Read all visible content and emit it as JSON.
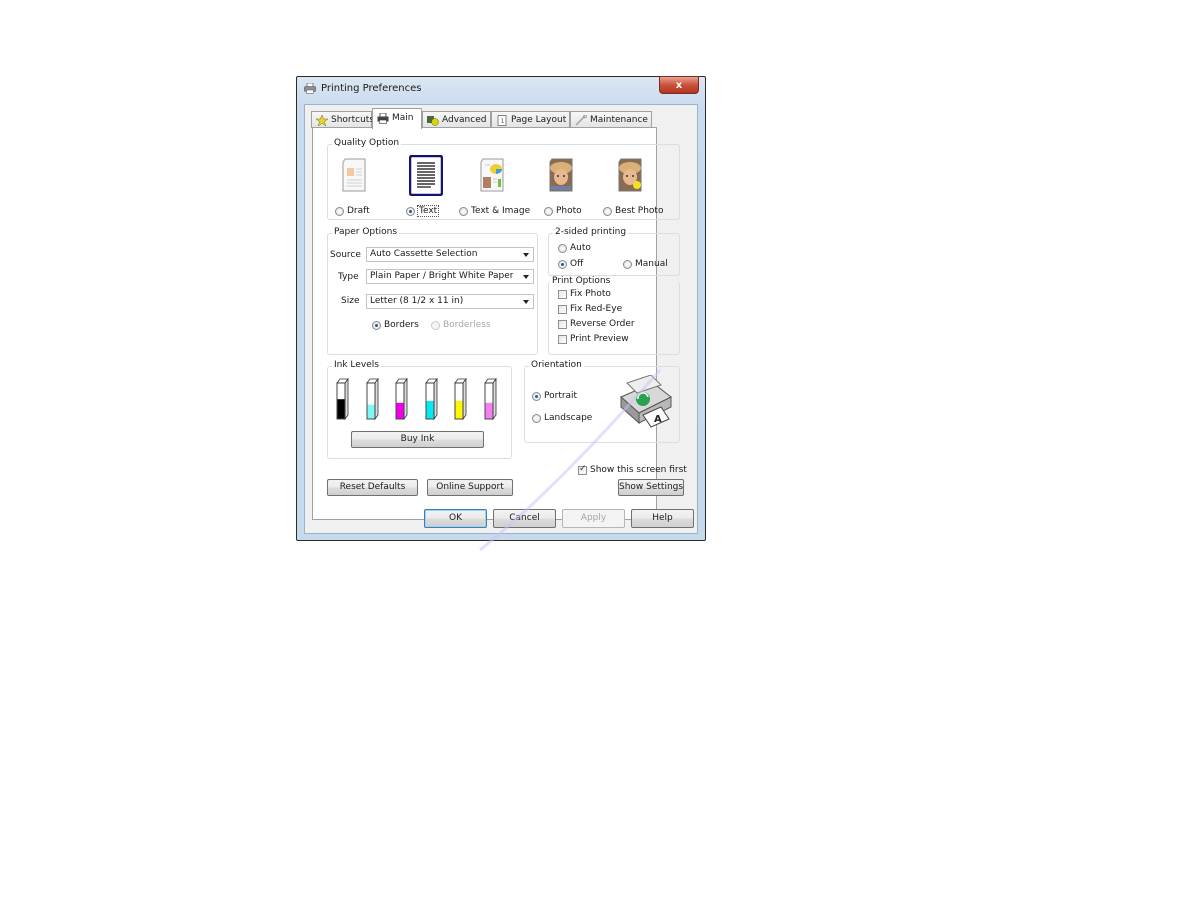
{
  "window": {
    "title": "Printing Preferences",
    "close_label": "x"
  },
  "tabs": [
    {
      "label": "Shortcuts",
      "icon": "star-icon",
      "active": false
    },
    {
      "label": "Main",
      "icon": "printer-icon",
      "active": true
    },
    {
      "label": "Advanced",
      "icon": "advanced-settings-icon",
      "active": false
    },
    {
      "label": "Page Layout",
      "icon": "page-layout-icon",
      "active": false
    },
    {
      "label": "Maintenance",
      "icon": "wrench-icon",
      "active": false
    }
  ],
  "quality": {
    "label": "Quality Option",
    "options": [
      {
        "label": "Draft",
        "selected": false
      },
      {
        "label": "Text",
        "selected": true
      },
      {
        "label": "Text & Image",
        "selected": false
      },
      {
        "label": "Photo",
        "selected": false
      },
      {
        "label": "Best Photo",
        "selected": false
      }
    ]
  },
  "paper": {
    "label": "Paper Options",
    "source_label": "Source",
    "source_value": "Auto Cassette Selection",
    "type_label": "Type",
    "type_value": "Plain Paper / Bright White Paper",
    "size_label": "Size",
    "size_value": "Letter (8 1/2 x 11 in)",
    "borders_label": "Borders",
    "borders_selected": true,
    "borderless_label": "Borderless",
    "borderless_enabled": false
  },
  "two_sided": {
    "label": "2-sided printing",
    "auto_label": "Auto",
    "off_label": "Off",
    "manual_label": "Manual",
    "selected": "Off"
  },
  "print_options": {
    "label": "Print Options",
    "items": [
      {
        "label": "Fix Photo",
        "checked": false
      },
      {
        "label": "Fix Red-Eye",
        "checked": false
      },
      {
        "label": "Reverse Order",
        "checked": false
      },
      {
        "label": "Print Preview",
        "checked": false
      }
    ]
  },
  "ink": {
    "label": "Ink Levels",
    "tanks": [
      {
        "name": "Black",
        "color": "#000000",
        "level": 0.55
      },
      {
        "name": "Light Cyan",
        "color": "#7ff7f7",
        "level": 0.4
      },
      {
        "name": "Magenta",
        "color": "#f000e8",
        "level": 0.45
      },
      {
        "name": "Cyan",
        "color": "#00eaf0",
        "level": 0.5
      },
      {
        "name": "Yellow",
        "color": "#fbf800",
        "level": 0.5
      },
      {
        "name": "Light Magenta",
        "color": "#f57ef0",
        "level": 0.45
      }
    ],
    "buy_label": "Buy Ink"
  },
  "orientation": {
    "label": "Orientation",
    "portrait_label": "Portrait",
    "landscape_label": "Landscape",
    "selected": "Portrait"
  },
  "show_first": {
    "label": "Show this screen first",
    "checked": true
  },
  "buttons": {
    "reset": "Reset Defaults",
    "online_support": "Online Support",
    "show_settings": "Show Settings",
    "ok": "OK",
    "cancel": "Cancel",
    "apply": "Apply",
    "help": "Help"
  },
  "colors": {
    "accent": "#1f5e9e",
    "selected_quality_border": "#1a1a7a"
  }
}
